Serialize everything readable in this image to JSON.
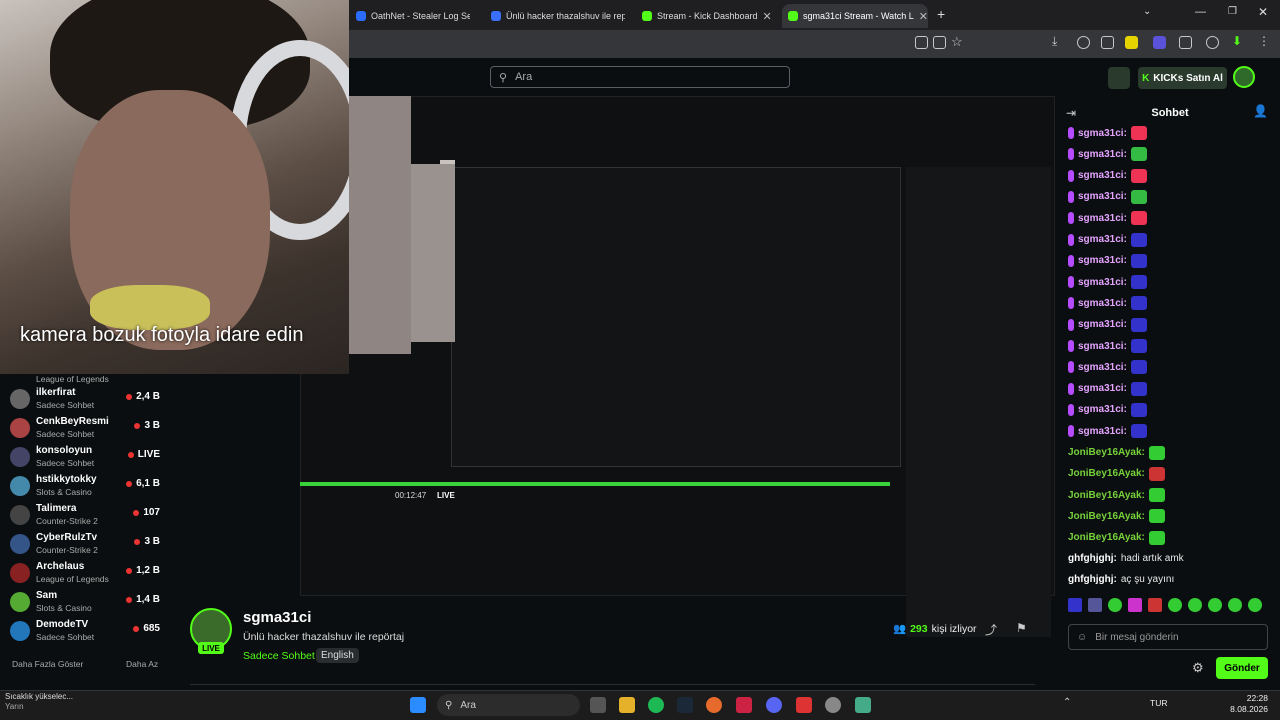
{
  "browser": {
    "tabs": [
      {
        "label": "OathNet - Stealer Log Search, B",
        "color": "#2a6cff"
      },
      {
        "label": "Ünlü hacker thazalshuv ile repörtaj",
        "color": "#3b6fff"
      },
      {
        "label": "Stream - Kick Dashboard",
        "color": "#53fc18"
      },
      {
        "label": "sgma31ci Stream - Watch L",
        "color": "#53fc18"
      }
    ]
  },
  "site": {
    "search_placeholder": "Ara",
    "kicks_label": "KICKs Satın Al"
  },
  "webcam": {
    "caption": "kamera bozuk fotoyla idare edin"
  },
  "sidebar": {
    "top_category": "League of Legends",
    "channels": [
      {
        "name": "ilkerfirat",
        "category": "Sadece Sohbet",
        "viewers": "2,4 B",
        "color": "#666"
      },
      {
        "name": "CenkBeyResmi",
        "category": "Sadece Sohbet",
        "viewers": "3 B",
        "color": "#a44"
      },
      {
        "name": "konsoloyun",
        "category": "Sadece Sohbet",
        "viewers": "LIVE",
        "color": "#446"
      },
      {
        "name": "hstikkytokky",
        "category": "Slots & Casino",
        "viewers": "6,1 B",
        "color": "#48a"
      },
      {
        "name": "Talimera",
        "category": "Counter-Strike 2",
        "viewers": "107",
        "color": "#444"
      },
      {
        "name": "CyberRulzTv",
        "category": "Counter-Strike 2",
        "viewers": "3 B",
        "color": "#358"
      },
      {
        "name": "Archelaus",
        "category": "League of Legends",
        "viewers": "1,2 B",
        "color": "#822"
      },
      {
        "name": "Sam",
        "category": "Slots & Casino",
        "viewers": "1,4 B",
        "color": "#5a3"
      },
      {
        "name": "DemodeTV",
        "category": "Sadece Sohbet",
        "viewers": "685",
        "color": "#27b"
      }
    ],
    "show_more": "Daha Fazla Göster",
    "show_less": "Daha Az"
  },
  "stream": {
    "channel": "sgma31ci",
    "title": "Ünlü hacker thazalshuv ile repörtaj",
    "category": "Sadece Sohbet",
    "language": "English",
    "viewers": "293",
    "viewers_label": "kişi izliyor"
  },
  "chat": {
    "header": "Sohbet",
    "messages": [
      {
        "user": "sgma31ci:",
        "emote": "#e35"
      },
      {
        "user": "sgma31ci:",
        "emote": "#3b4"
      },
      {
        "user": "sgma31ci:",
        "emote": "#e35"
      },
      {
        "user": "sgma31ci:",
        "emote": "#3b4"
      },
      {
        "user": "sgma31ci:",
        "emote": "#e35"
      },
      {
        "user": "sgma31ci:",
        "emote": "#33c"
      },
      {
        "user": "sgma31ci:",
        "emote": "#33c"
      },
      {
        "user": "sgma31ci:",
        "emote": "#33c"
      },
      {
        "user": "sgma31ci:",
        "emote": "#33c"
      },
      {
        "user": "sgma31ci:",
        "emote": "#33c"
      },
      {
        "user": "sgma31ci:",
        "emote": "#33c"
      },
      {
        "user": "sgma31ci:",
        "emote": "#33c"
      },
      {
        "user": "sgma31ci:",
        "emote": "#33c"
      },
      {
        "user": "sgma31ci:",
        "emote": "#33c"
      },
      {
        "user": "sgma31ci:",
        "emote": "#33c"
      },
      {
        "user": "JoniBey16Ayak:",
        "emote": "#3c3"
      },
      {
        "user": "JoniBey16Ayak:",
        "emote": "#c33"
      },
      {
        "user": "JoniBey16Ayak:",
        "emote": "#3c3"
      },
      {
        "user": "JoniBey16Ayak:",
        "emote": "#3c3"
      },
      {
        "user": "JoniBey16Ayak:",
        "emote": "#3c3"
      }
    ],
    "text_messages": [
      {
        "user": "ghfghjghj:",
        "text": "hadi artık amk"
      },
      {
        "user": "ghfghjghj:",
        "text": "aç şu yayını"
      }
    ],
    "input_placeholder": "Bir mesaj gönderin",
    "send_label": "Gönder"
  },
  "taskbar": {
    "weather": "Sıcaklık yükselec...",
    "weather_sub": "Yarın",
    "search_label": "Ara",
    "lang": "TUR",
    "time": "22:28",
    "date": "8.08.2026"
  },
  "player": {
    "time": "00:12:47",
    "live": "LIVE"
  }
}
